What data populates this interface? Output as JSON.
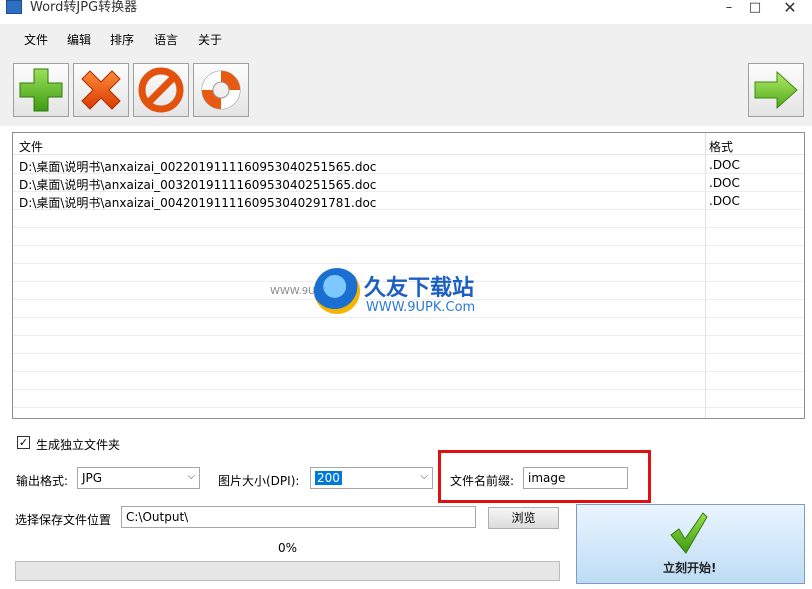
{
  "window": {
    "title": "Word转JPG转换器",
    "min_glyph": "–",
    "max_glyph": "□",
    "close_glyph": "✕"
  },
  "menu": {
    "items": [
      "文件",
      "编辑",
      "排序",
      "语言",
      "关于"
    ]
  },
  "toolbar": {
    "add_icon": "plus-icon",
    "remove_icon": "x-icon",
    "clear_icon": "no-entry-icon",
    "help_icon": "lifebuoy-icon",
    "next_icon": "arrow-right-icon"
  },
  "file_list": {
    "headers": {
      "file": "文件",
      "format": "格式"
    },
    "rows": [
      {
        "file": "D:\\桌面\\说明书\\anxaizai_0022019111160953040251565.doc",
        "format": ".DOC"
      },
      {
        "file": "D:\\桌面\\说明书\\anxaizai_0032019111160953040251565.doc",
        "format": ".DOC"
      },
      {
        "file": "D:\\桌面\\说明书\\anxaizai_0042019111160953040291781.doc",
        "format": ".DOC"
      }
    ]
  },
  "watermark": {
    "title": "久友下载站",
    "url": "WWW.9UPK.Com",
    "small": "WWW.9UPK.COM"
  },
  "options": {
    "separate_folder_label": "生成独立文件夹",
    "separate_folder_checked": true,
    "check_glyph": "✓",
    "output_format_label": "输出格式:",
    "output_format_value": "JPG",
    "dpi_label": "图片大小(DPI):",
    "dpi_value": "200",
    "prefix_label": "文件名前缀:",
    "prefix_value": "image",
    "combo_arrow": "⌵"
  },
  "save": {
    "label": "选择保存文件位置",
    "path": "C:\\Output\\",
    "browse_label": "浏览"
  },
  "progress": {
    "text": "0%",
    "fraction": 0
  },
  "start": {
    "label": "立刻开始!"
  },
  "colors": {
    "accent_blue": "#0078d7",
    "highlight_red": "#e01010",
    "green_check": "#5ab82e"
  }
}
